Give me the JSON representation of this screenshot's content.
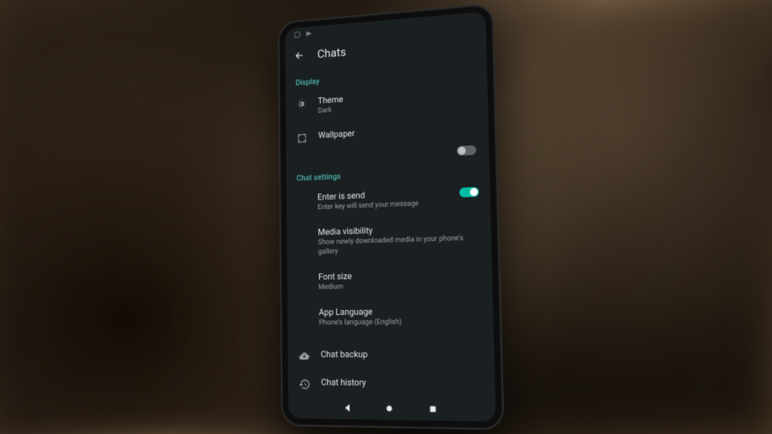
{
  "header": {
    "title": "Chats"
  },
  "sections": {
    "display": {
      "label": "Display",
      "theme": {
        "title": "Theme",
        "value": "Dark"
      },
      "wallpaper": {
        "title": "Wallpaper"
      }
    },
    "chat_settings": {
      "label": "Chat settings",
      "enter_send": {
        "title": "Enter is send",
        "subtitle": "Enter key will send your message",
        "enabled": true
      },
      "media_visibility": {
        "title": "Media visibility",
        "subtitle": "Show newly downloaded media in your phone's gallery"
      },
      "font_size": {
        "title": "Font size",
        "value": "Medium"
      },
      "app_language": {
        "title": "App Language",
        "value": "Phone's language (English)"
      }
    },
    "more": {
      "chat_backup": {
        "title": "Chat backup"
      },
      "chat_history": {
        "title": "Chat history"
      }
    }
  },
  "misc_toggle": {
    "enabled": false
  }
}
